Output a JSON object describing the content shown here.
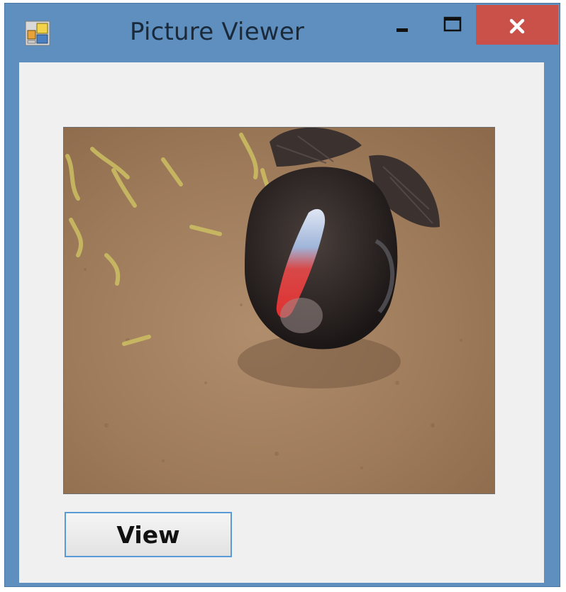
{
  "window": {
    "title": "Picture Viewer",
    "titlebar_color": "#5e8fbf",
    "close_button_color": "#c9514a",
    "controls": [
      "minimize-icon",
      "maximize-icon",
      "close-icon"
    ]
  },
  "main": {
    "picture_description_icon": "photo-turkey",
    "view_button_label": "View",
    "button_focus_color": "#5a9ad6"
  }
}
